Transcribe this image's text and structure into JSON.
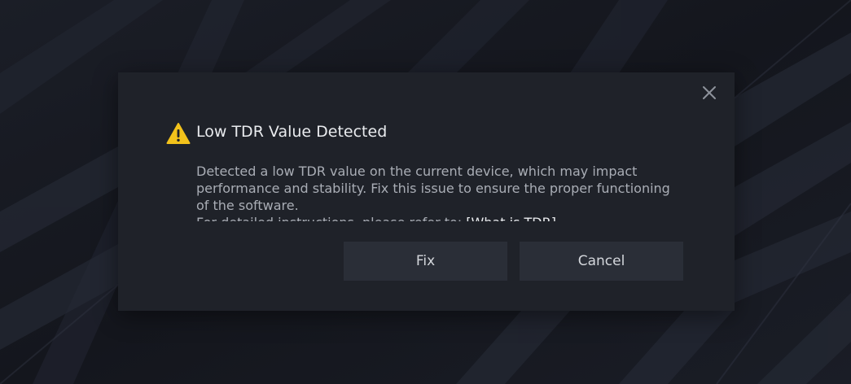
{
  "dialog": {
    "title": "Low TDR Value Detected",
    "message_line1": "Detected a low TDR value on the current device, which may impact performance and stability. Fix this issue to ensure the proper functioning of the software.",
    "message_line2_prefix": "For detailed instructions, please refer to: ",
    "message_link": "[What is TDR]",
    "fix_label": "Fix",
    "cancel_label": "Cancel",
    "icons": {
      "warning": "warning-triangle-icon",
      "close": "close-icon"
    },
    "colors": {
      "warning": "#f2c21b",
      "background": "#1f2229",
      "button": "#2a2e37"
    }
  }
}
